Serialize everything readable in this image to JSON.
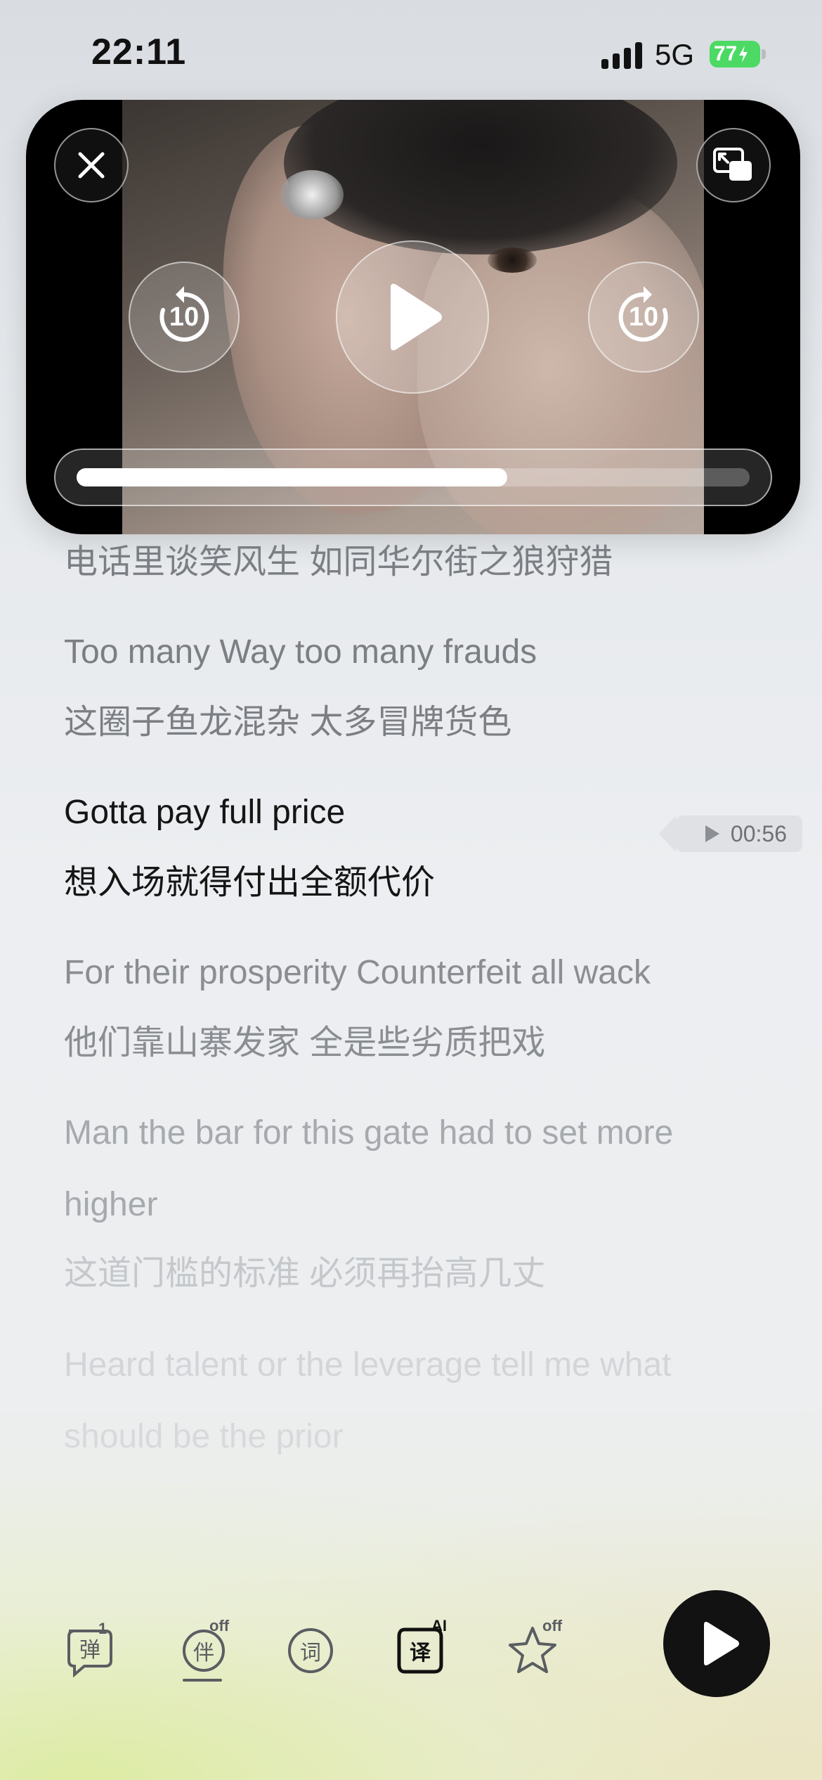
{
  "status_bar": {
    "time": "22:11",
    "network": "5G",
    "battery": "77"
  },
  "video": {
    "close_icon": "close-icon",
    "pip_icon": "picture-in-picture-icon",
    "rewind_label": "10",
    "forward_label": "10",
    "progress_fraction": 0.64
  },
  "lyrics": [
    {
      "text": "电话里谈笑风生 如同华尔街之狼狩猎"
    },
    {
      "text": "Too many Way too many frauds"
    },
    {
      "text": "这圈子鱼龙混杂 太多冒牌货色"
    },
    {
      "text": "Gotta pay full price"
    },
    {
      "text": "想入场就得付出全额代价"
    },
    {
      "text": "For their prosperity Counterfeit all wack"
    },
    {
      "text": "他们靠山寨发家 全是些劣质把戏"
    },
    {
      "text": "Man the bar for this gate had to set more"
    },
    {
      "text": "higher"
    },
    {
      "text": "这道门槛的标准 必须再抬高几丈"
    },
    {
      "text": "Heard talent or the leverage tell me what"
    },
    {
      "text": "should be the prior"
    }
  ],
  "seek_tag": {
    "time": "00:56"
  },
  "toolbar": {
    "danmaku": {
      "glyph": "弹",
      "badge": "1"
    },
    "accompany": {
      "glyph": "伴",
      "badge": "off"
    },
    "word": {
      "glyph": "词"
    },
    "translate": {
      "glyph": "译",
      "badge": "AI"
    },
    "favorite": {
      "badge": "off"
    }
  },
  "colors": {
    "accent_dark": "#121212",
    "battery_green": "#4cd964",
    "current_lyric": "#151515"
  }
}
